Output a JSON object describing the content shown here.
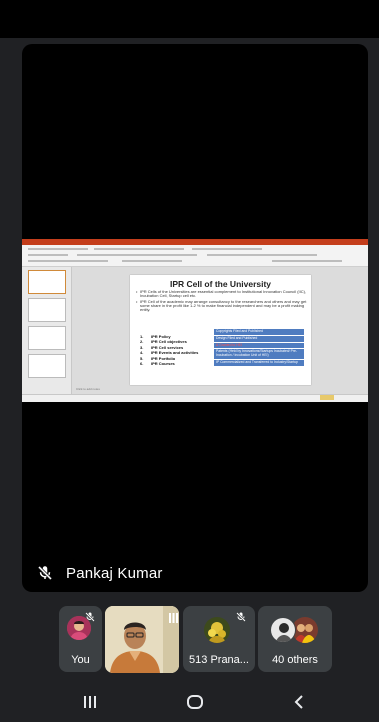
{
  "stage": {
    "presenter_name": "Pankaj Kumar"
  },
  "slide": {
    "title": "IPR Cell of the University",
    "bullets": [
      "IPR Cells of the Universities are essential complement to Institutional Innovation Council (IIC), Incubation Cell, Startup cell etc.",
      "IPR Cell of the academic may arrange consultancy to the researchers and others and may get some share in the profit like 1-2 % to make financial independent and may be a profit making entity."
    ],
    "menu": [
      {
        "num": "1.",
        "label": "IPR Policy"
      },
      {
        "num": "2.",
        "label": "IPR Cell objectives"
      },
      {
        "num": "3.",
        "label": "IPR Cell services"
      },
      {
        "num": "4.",
        "label": "IPR Events and activities"
      },
      {
        "num": "5.",
        "label": "IPR Portfolio"
      },
      {
        "num": "6.",
        "label": "IPR Courses"
      }
    ],
    "cells": [
      "Copyrights Filed and Published",
      "Design Filed and Published",
      "& Granted to HEI",
      "Patents (Held by Innovations/Startups Incubated/ Pre-Incubation / Incubation Unit of HEI)",
      "IP Commercialized and Transferred to Industry/Startup"
    ],
    "notes_placeholder": "Click to add notes"
  },
  "participants": {
    "you_label": "You",
    "participant_label": "513 Prana...",
    "others_label": "40 others"
  },
  "colors": {
    "background": "#202124",
    "tile": "#3c4043",
    "ppt_accent": "#c43e1c",
    "slide_cell": "#4f7cc0"
  },
  "icons": {
    "presenter_mic": "mic-off-icon",
    "you_mic": "mic-off-icon",
    "participant_mic": "mic-off-icon",
    "self_view_audio": "audio-bars-icon",
    "nav_recent": "recent-apps-icon",
    "nav_home": "home-icon",
    "nav_back": "back-icon"
  }
}
